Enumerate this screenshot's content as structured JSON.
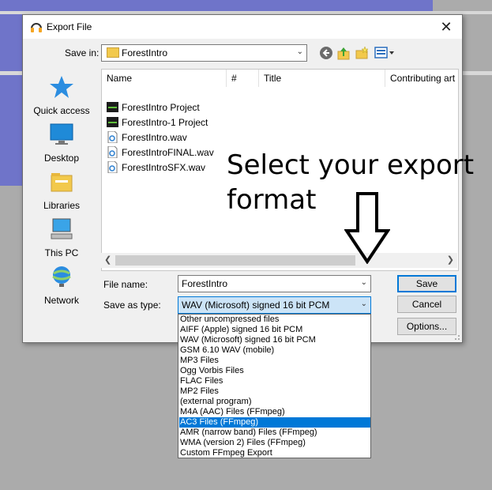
{
  "dialog": {
    "title": "Export File",
    "close_glyph": "✕",
    "save_in_label": "Save in:",
    "save_in_value": "ForestIntro",
    "toolbar_icons": [
      "back-icon",
      "up-folder-icon",
      "new-folder-icon",
      "view-menu-icon"
    ]
  },
  "places": [
    {
      "label": "Quick access",
      "icon": "quick-access-icon"
    },
    {
      "label": "Desktop",
      "icon": "desktop-icon"
    },
    {
      "label": "Libraries",
      "icon": "libraries-icon"
    },
    {
      "label": "This PC",
      "icon": "this-pc-icon"
    },
    {
      "label": "Network",
      "icon": "network-icon"
    }
  ],
  "file_list": {
    "columns": [
      "Name",
      "#",
      "Title",
      "Contributing art"
    ],
    "files": [
      {
        "name": "ForestIntro Project",
        "icon": "project-file-icon"
      },
      {
        "name": "ForestIntro-1 Project",
        "icon": "project-file-icon"
      },
      {
        "name": "ForestIntro.wav",
        "icon": "audio-file-icon"
      },
      {
        "name": "ForestIntroFINAL.wav",
        "icon": "audio-file-icon"
      },
      {
        "name": "ForestIntroSFX.wav",
        "icon": "audio-file-icon"
      }
    ]
  },
  "form": {
    "file_name_label": "File name:",
    "file_name_value": "ForestIntro",
    "save_as_type_label": "Save as type:",
    "save_as_type_value": "WAV (Microsoft) signed 16 bit PCM"
  },
  "buttons": {
    "save": "Save",
    "cancel": "Cancel",
    "options": "Options..."
  },
  "type_options": [
    "Other uncompressed files",
    "AIFF (Apple) signed 16 bit PCM",
    "WAV (Microsoft) signed 16 bit PCM",
    "GSM 6.10 WAV (mobile)",
    "MP3 Files",
    "Ogg Vorbis Files",
    "FLAC Files",
    "MP2 Files",
    "(external program)",
    "M4A (AAC) Files (FFmpeg)",
    "AC3 Files (FFmpeg)",
    "AMR (narrow band) Files (FFmpeg)",
    "WMA (version 2) Files (FFmpeg)",
    "Custom FFmpeg Export"
  ],
  "highlighted_option_index": 10,
  "annotation": {
    "line1": "Select your export",
    "line2": "format"
  },
  "colors": {
    "accent": "#0078d7",
    "waveform": "#6f74c9",
    "background": "#ababab"
  }
}
